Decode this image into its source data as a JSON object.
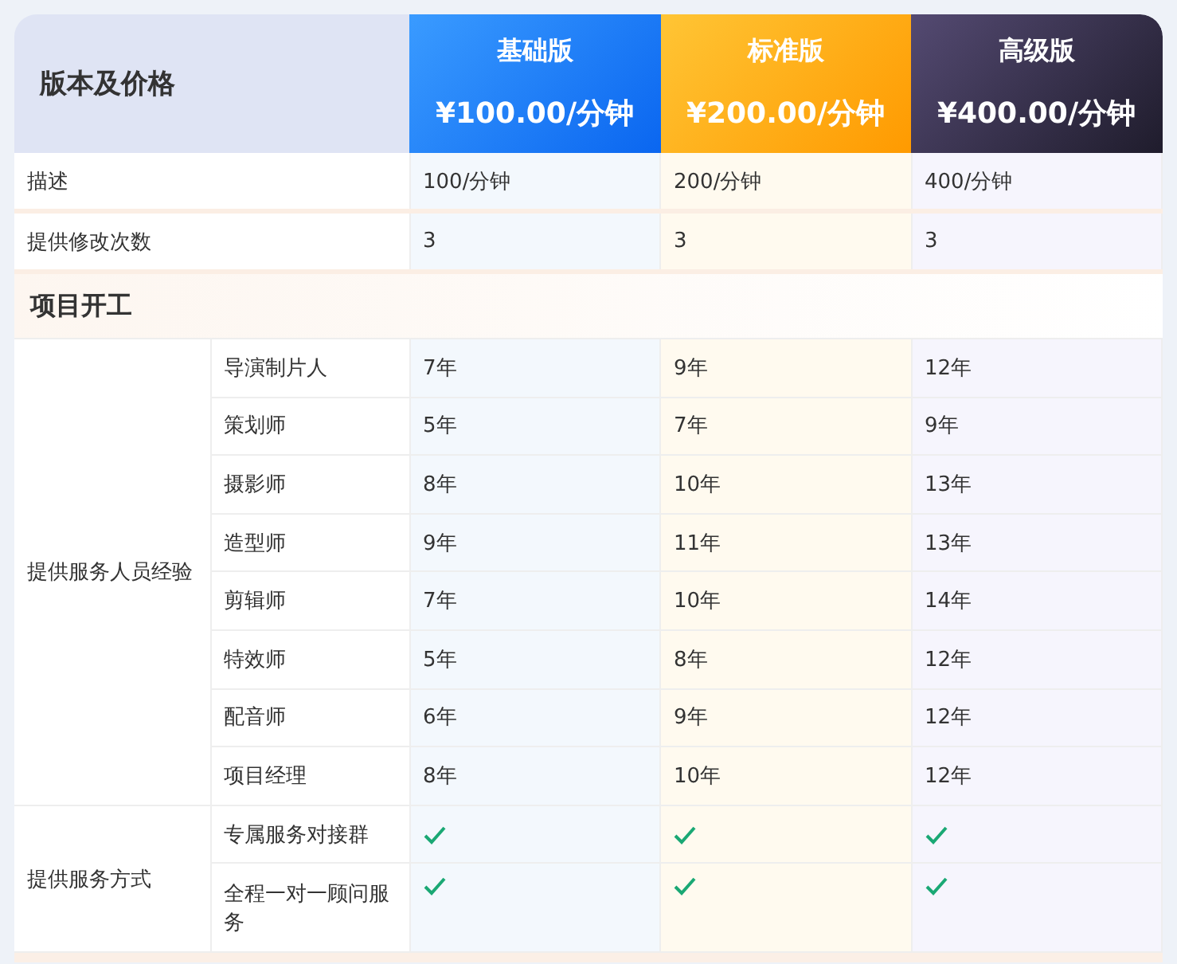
{
  "header": {
    "title": "版本及价格",
    "plans": [
      {
        "kind": "basic",
        "name": "基础版",
        "price": "¥100.00/分钟"
      },
      {
        "kind": "standard",
        "name": "标准版",
        "price": "¥200.00/分钟"
      },
      {
        "kind": "premium",
        "name": "高级版",
        "price": "¥400.00/分钟"
      }
    ]
  },
  "rows": [
    {
      "label": "描述",
      "values": [
        "100/分钟",
        "200/分钟",
        "400/分钟"
      ]
    },
    {
      "label": "提供修改次数",
      "values": [
        "3",
        "3",
        "3"
      ]
    }
  ],
  "sections": [
    {
      "title": "项目开工",
      "groups": [
        {
          "label": "提供服务人员经验",
          "items": [
            {
              "kind": "text",
              "label": "导演制片人",
              "values": [
                "7年",
                "9年",
                "12年"
              ]
            },
            {
              "kind": "text",
              "label": "策划师",
              "values": [
                "5年",
                "7年",
                "9年"
              ]
            },
            {
              "kind": "text",
              "label": "摄影师",
              "values": [
                "8年",
                "10年",
                "13年"
              ]
            },
            {
              "kind": "text",
              "label": "造型师",
              "values": [
                "9年",
                "11年",
                "13年"
              ]
            },
            {
              "kind": "text",
              "label": "剪辑师",
              "values": [
                "7年",
                "10年",
                "14年"
              ]
            },
            {
              "kind": "text",
              "label": "特效师",
              "values": [
                "5年",
                "8年",
                "12年"
              ]
            },
            {
              "kind": "text",
              "label": "配音师",
              "values": [
                "6年",
                "9年",
                "12年"
              ]
            },
            {
              "kind": "text",
              "label": "项目经理",
              "values": [
                "8年",
                "10年",
                "12年"
              ]
            }
          ]
        },
        {
          "label": "提供服务方式",
          "items": [
            {
              "kind": "check",
              "label": "专属服务对接群",
              "checks": [
                true,
                true,
                true
              ]
            },
            {
              "kind": "check",
              "label": "全程一对一顾问服务",
              "checks": [
                true,
                true,
                true
              ]
            }
          ]
        }
      ]
    }
  ]
}
